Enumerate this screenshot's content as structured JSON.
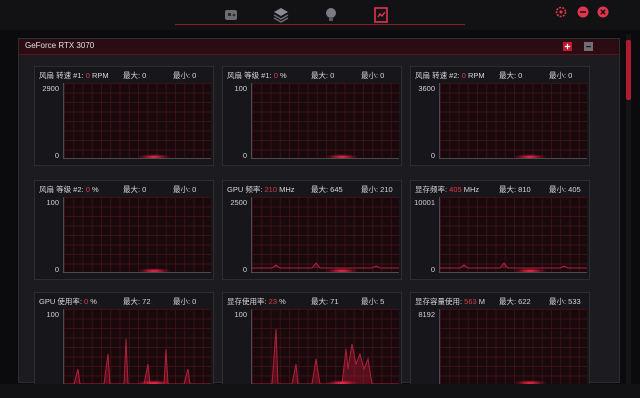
{
  "nav": {
    "tabs": [
      {
        "name": "tab-dashboard",
        "icon": "gamepad-icon"
      },
      {
        "name": "tab-layers",
        "icon": "layers-icon"
      },
      {
        "name": "tab-lighting",
        "icon": "bulb-icon"
      },
      {
        "name": "tab-monitor",
        "icon": "monitor-icon",
        "active": true
      }
    ],
    "window_controls": [
      "gear-icon",
      "minimize-icon",
      "close-icon"
    ]
  },
  "panel": {
    "title": "GeForce RTX 3070"
  },
  "cards": [
    {
      "label": "风扇 转速 #1: ",
      "value": "0",
      "unit": " RPM",
      "max": "最大: 0",
      "min": "最小: 0",
      "ymax": "2900",
      "ymin": "0",
      "trace": "flat"
    },
    {
      "label": "风扇 等级 #1: ",
      "value": "0",
      "unit": " %",
      "max": "最大: 0",
      "min": "最小: 0",
      "ymax": "100",
      "ymin": "0",
      "trace": "flat"
    },
    {
      "label": "风扇 转速 #2: ",
      "value": "0",
      "unit": " RPM",
      "max": "最大: 0",
      "min": "最小: 0",
      "ymax": "3600",
      "ymin": "0",
      "trace": "flat"
    },
    {
      "label": "风扇 等级 #2: ",
      "value": "0",
      "unit": " %",
      "max": "最大: 0",
      "min": "最小: 0",
      "ymax": "100",
      "ymin": "0",
      "trace": "flat"
    },
    {
      "label": "GPU 频率: ",
      "value": "210",
      "unit": " MHz",
      "max": "最大: 645",
      "min": "最小: 210",
      "ymax": "2500",
      "ymin": "0",
      "trace": "low"
    },
    {
      "label": "显存频率: ",
      "value": "405",
      "unit": " MHz",
      "max": "最大: 810",
      "min": "最小: 405",
      "ymax": "10001",
      "ymin": "0",
      "trace": "low"
    },
    {
      "label": "GPU 使用率: ",
      "value": "0",
      "unit": " %",
      "max": "最大: 72",
      "min": "最小: 0",
      "ymax": "100",
      "ymin": "",
      "trace": "spiky"
    },
    {
      "label": "显存使用率: ",
      "value": "23",
      "unit": " %",
      "max": "最大: 71",
      "min": "最小: 5",
      "ymax": "100",
      "ymin": "",
      "trace": "spiky2"
    },
    {
      "label": "显存容量使用: ",
      "value": "563",
      "unit": " M",
      "max": "最大: 622",
      "min": "最小: 533",
      "ymax": "8192",
      "ymin": "",
      "trace": "none"
    }
  ],
  "colors": {
    "accent": "#e0364f",
    "bg": "#0b0b0d",
    "panel": "#1b1b20"
  }
}
